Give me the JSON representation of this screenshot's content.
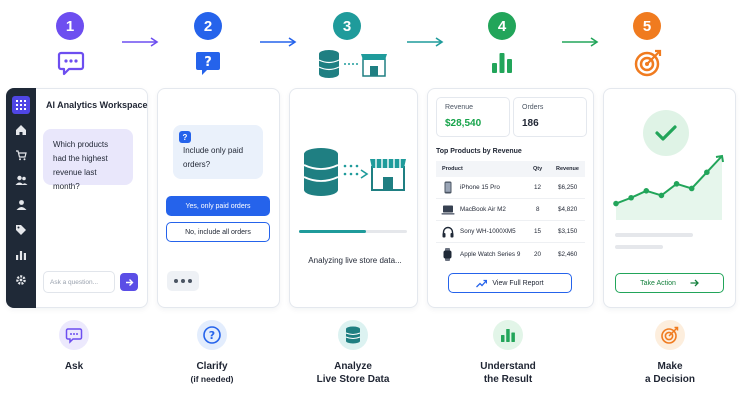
{
  "steps": [
    {
      "number": "1",
      "color": "#6d4ef0",
      "label": "Ask",
      "sub": ""
    },
    {
      "number": "2",
      "color": "#2563eb",
      "label": "Clarify",
      "sub": "(if needed)"
    },
    {
      "number": "3",
      "color": "#1f9b9b",
      "label": "Analyze",
      "sub": "Live Store Data"
    },
    {
      "number": "4",
      "color": "#22a55a",
      "label": "Understand",
      "sub": "the Result"
    },
    {
      "number": "5",
      "color": "#f07b1f",
      "label": "Make",
      "sub": "a Decision"
    }
  ],
  "ask_card": {
    "title": "AI Analytics Workspace",
    "question": "Which products had the highest revenue last month?",
    "input_placeholder": "Ask a question..."
  },
  "clarify_card": {
    "question": "Include only paid orders?",
    "primary_option": "Yes, only paid orders",
    "secondary_option": "No, include all orders"
  },
  "analyze_card": {
    "status": "Analyzing live store data...",
    "progress": 0.62
  },
  "result_card": {
    "revenue_label": "Revenue",
    "revenue_value": "$28,540",
    "orders_label": "Orders",
    "orders_value": "186",
    "table_title": "Top Products by Revenue",
    "columns": [
      "Product",
      "Qty",
      "Revenue"
    ],
    "rows": [
      {
        "product": "iPhone 15 Pro",
        "qty": "12",
        "revenue": "$6,250",
        "icon": "phone-icon"
      },
      {
        "product": "MacBook Air M2",
        "qty": "8",
        "revenue": "$4,820",
        "icon": "laptop-icon"
      },
      {
        "product": "Sony WH-1000XM5",
        "qty": "15",
        "revenue": "$3,150",
        "icon": "headphones-icon"
      },
      {
        "product": "Apple Watch Series 9",
        "qty": "20",
        "revenue": "$2,460",
        "icon": "watch-icon"
      }
    ],
    "view_button": "View Full Report"
  },
  "decision_card": {
    "action_button": "Take Action",
    "trend": [
      0.18,
      0.28,
      0.4,
      0.32,
      0.52,
      0.44,
      0.72,
      1.0
    ]
  },
  "colors": {
    "purple": "#6d4ef0",
    "blue": "#2563eb",
    "teal": "#1f9b9b",
    "green": "#22a55a",
    "orange": "#f07b1f",
    "sidebar": "#1f2937"
  }
}
